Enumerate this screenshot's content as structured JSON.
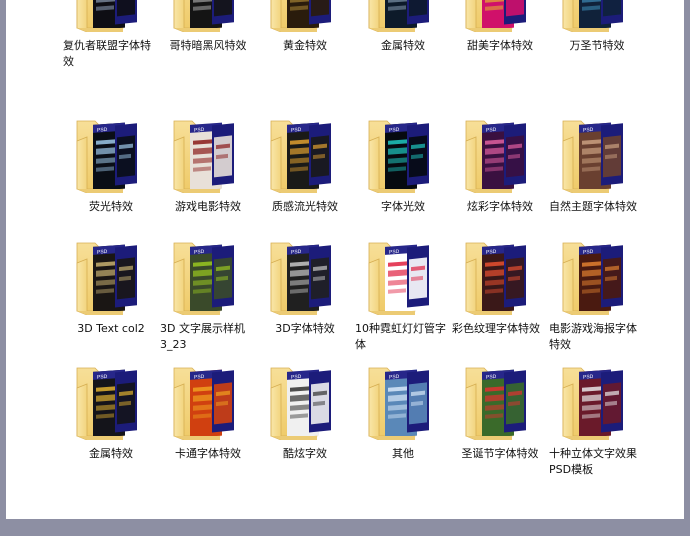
{
  "folders": [
    {
      "label": "复仇者联盟字体特效",
      "align": "left",
      "art": "dark",
      "accent": "#b0c4de",
      "cover": "#0e0e14"
    },
    {
      "label": "哥特暗黑风特效",
      "align": "center",
      "art": "dark",
      "accent": "#c9c9c9",
      "cover": "#141414"
    },
    {
      "label": "黄金特效",
      "align": "center",
      "art": "gold",
      "accent": "#c8a040",
      "cover": "#2a1c0c"
    },
    {
      "label": "金属特效",
      "align": "center",
      "art": "dark",
      "accent": "#9fb6cc",
      "cover": "#0d1a2a"
    },
    {
      "label": "甜美字体特效",
      "align": "center",
      "art": "pink",
      "accent": "#e8e020",
      "cover": "#d0106a"
    },
    {
      "label": "万圣节特效",
      "align": "center",
      "art": "dark",
      "accent": "#4aa8d8",
      "cover": "#10223a"
    },
    {
      "label": "荧光特效",
      "align": "center",
      "art": "dark",
      "accent": "#9ec8e8",
      "cover": "#0a0e16"
    },
    {
      "label": "游戏电影特效",
      "align": "center",
      "art": "light",
      "accent": "#8a1a1a",
      "cover": "#e8e0d8"
    },
    {
      "label": "质感流光特效",
      "align": "center",
      "art": "dark",
      "accent": "#e0a030",
      "cover": "#1a1a18"
    },
    {
      "label": "字体光效",
      "align": "center",
      "art": "dark",
      "accent": "#20c8c0",
      "cover": "#060a10"
    },
    {
      "label": "炫彩字体特效",
      "align": "center",
      "art": "pink",
      "accent": "#e060a0",
      "cover": "#3a1040"
    },
    {
      "label": "自然主题字体特效",
      "align": "left",
      "art": "wood",
      "accent": "#caa080",
      "cover": "#6a4030"
    },
    {
      "label": "3D Text col2",
      "align": "center",
      "art": "dark",
      "accent": "#c8b070",
      "cover": "#1a1614"
    },
    {
      "label": "3D 文字展示样机3_23",
      "align": "left",
      "art": "green",
      "accent": "#9ac820",
      "cover": "#3a4a2a"
    },
    {
      "label": "3D字体特效",
      "align": "center",
      "art": "dark",
      "accent": "#c8c8c8",
      "cover": "#202020"
    },
    {
      "label": "10种霓虹灯灯管字体",
      "align": "left",
      "art": "neon",
      "accent": "#e02040",
      "cover": "#ffffff"
    },
    {
      "label": "彩色纹理字体特效",
      "align": "left",
      "art": "orange",
      "accent": "#e85030",
      "cover": "#3a1818"
    },
    {
      "label": "电影游戏海报字体特效",
      "align": "left",
      "art": "orange",
      "accent": "#e08030",
      "cover": "#4a1a10"
    },
    {
      "label": "金属特效",
      "align": "center",
      "art": "gold",
      "accent": "#e0b030",
      "cover": "#14141a"
    },
    {
      "label": "卡通字体特效",
      "align": "center",
      "art": "orange",
      "accent": "#f0a020",
      "cover": "#d04010"
    },
    {
      "label": "酷炫字效",
      "align": "center",
      "art": "light",
      "accent": "#303030",
      "cover": "#f0f0f0"
    },
    {
      "label": "其他",
      "align": "center",
      "art": "blue",
      "accent": "#d8e8f8",
      "cover": "#5a88b8"
    },
    {
      "label": "圣诞节字体特效",
      "align": "center",
      "art": "green",
      "accent": "#e03030",
      "cover": "#3a6a2a"
    },
    {
      "label": "十种立体文字效果PSD模板",
      "align": "left",
      "art": "wine",
      "accent": "#e8e8e8",
      "cover": "#6a1a2a"
    }
  ]
}
